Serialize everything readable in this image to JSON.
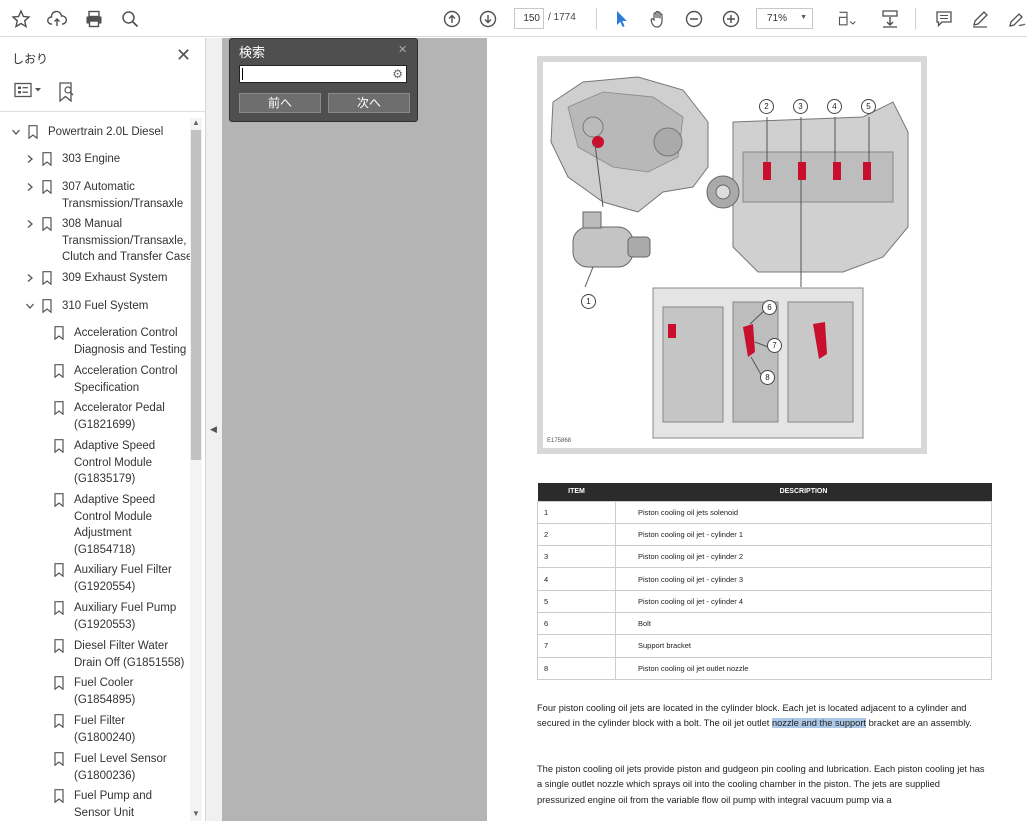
{
  "toolbar": {
    "page_current": "150",
    "page_total": "/ 1774",
    "zoom": "71%"
  },
  "sidebar": {
    "title": "しおり",
    "items": [
      {
        "label": "Powertrain 2.0L Diesel",
        "lines": [
          "Powertrain 2.0L Diesel"
        ]
      },
      {
        "label": "303 Engine",
        "lines": [
          "303 Engine"
        ]
      },
      {
        "label": "307 Automatic Transmission/Transaxle",
        "lines": [
          "307 Automatic",
          "Transmission/Transaxle"
        ]
      },
      {
        "label": "308 Manual Transmission/Transaxle, Clutch and Transfer Case",
        "lines": [
          "308 Manual",
          "Transmission/Transaxle,",
          "Clutch and Transfer Case"
        ]
      },
      {
        "label": "309 Exhaust System",
        "lines": [
          "309 Exhaust System"
        ]
      },
      {
        "label": "310 Fuel System",
        "lines": [
          "310 Fuel System"
        ]
      },
      {
        "label": "Acceleration Control Diagnosis and Testing",
        "lines": [
          "Acceleration Control",
          "Diagnosis and Testing"
        ]
      },
      {
        "label": "Acceleration Control Specification",
        "lines": [
          "Acceleration Control",
          "Specification"
        ]
      },
      {
        "label": "Accelerator Pedal (G1821699)",
        "lines": [
          "Accelerator Pedal",
          "(G1821699)"
        ]
      },
      {
        "label": "Adaptive Speed Control Module (G1835179)",
        "lines": [
          "Adaptive Speed",
          "Control Module",
          "(G1835179)"
        ]
      },
      {
        "label": "Adaptive Speed Control Module Adjustment (G1854718)",
        "lines": [
          "Adaptive Speed",
          "Control Module",
          "Adjustment",
          "(G1854718)"
        ]
      },
      {
        "label": "Auxiliary Fuel Filter (G1920554)",
        "lines": [
          "Auxiliary Fuel Filter",
          "(G1920554)"
        ]
      },
      {
        "label": "Auxiliary Fuel Pump (G1920553)",
        "lines": [
          "Auxiliary Fuel Pump",
          "(G1920553)"
        ]
      },
      {
        "label": "Diesel Filter Water Drain Off (G1851558)",
        "lines": [
          "Diesel Filter Water",
          "Drain Off (G1851558)"
        ]
      },
      {
        "label": "Fuel Cooler (G1854895)",
        "lines": [
          "Fuel Cooler",
          "(G1854895)"
        ]
      },
      {
        "label": "Fuel Filter (G1800240)",
        "lines": [
          "Fuel Filter",
          "(G1800240)"
        ]
      },
      {
        "label": "Fuel Level Sensor (G1800236)",
        "lines": [
          "Fuel Level Sensor",
          "(G1800236)"
        ]
      },
      {
        "label": "Fuel Pump and Sensor Unit",
        "lines": [
          "Fuel Pump and",
          "Sensor Unit"
        ]
      }
    ]
  },
  "find": {
    "title": "検索",
    "prev": "前へ",
    "next": "次へ",
    "value": ""
  },
  "document": {
    "figure_code": "E175868",
    "callouts": [
      "1",
      "2",
      "3",
      "4",
      "5",
      "6",
      "7",
      "8"
    ],
    "table": {
      "headers": [
        "ITEM",
        "DESCRIPTION"
      ],
      "rows": [
        [
          "1",
          "Piston cooling oil jets solenoid"
        ],
        [
          "2",
          "Piston cooling oil jet - cylinder 1"
        ],
        [
          "3",
          "Piston cooling oil jet - cylinder 2"
        ],
        [
          "4",
          "Piston cooling oil jet - cylinder 3"
        ],
        [
          "5",
          "Piston cooling oil jet - cylinder 4"
        ],
        [
          "6",
          "Bolt"
        ],
        [
          "7",
          "Support bracket"
        ],
        [
          "8",
          "Piston cooling oil jet outlet nozzle"
        ]
      ]
    },
    "para1_before": "Four piston cooling oil jets are located in the cylinder block. Each jet is located adjacent to a cylinder and secured in the cylinder block with a bolt. The oil jet outlet ",
    "para1_highlight": "nozzle and the support",
    "para1_after": " bracket are an assembly.",
    "para2": "The piston cooling oil jets provide piston and gudgeon pin cooling and lubrication. Each piston cooling jet has a single outlet nozzle which sprays oil into the cooling chamber in the piston. The jets are supplied pressurized engine oil from the variable flow oil pump with integral vacuum pump via a"
  },
  "colors": {
    "accent": "#2d7bd9",
    "highlight": "#aac8e6",
    "find_panel": "#4f4f4f",
    "viewer_bg": "#b4b4b4"
  }
}
